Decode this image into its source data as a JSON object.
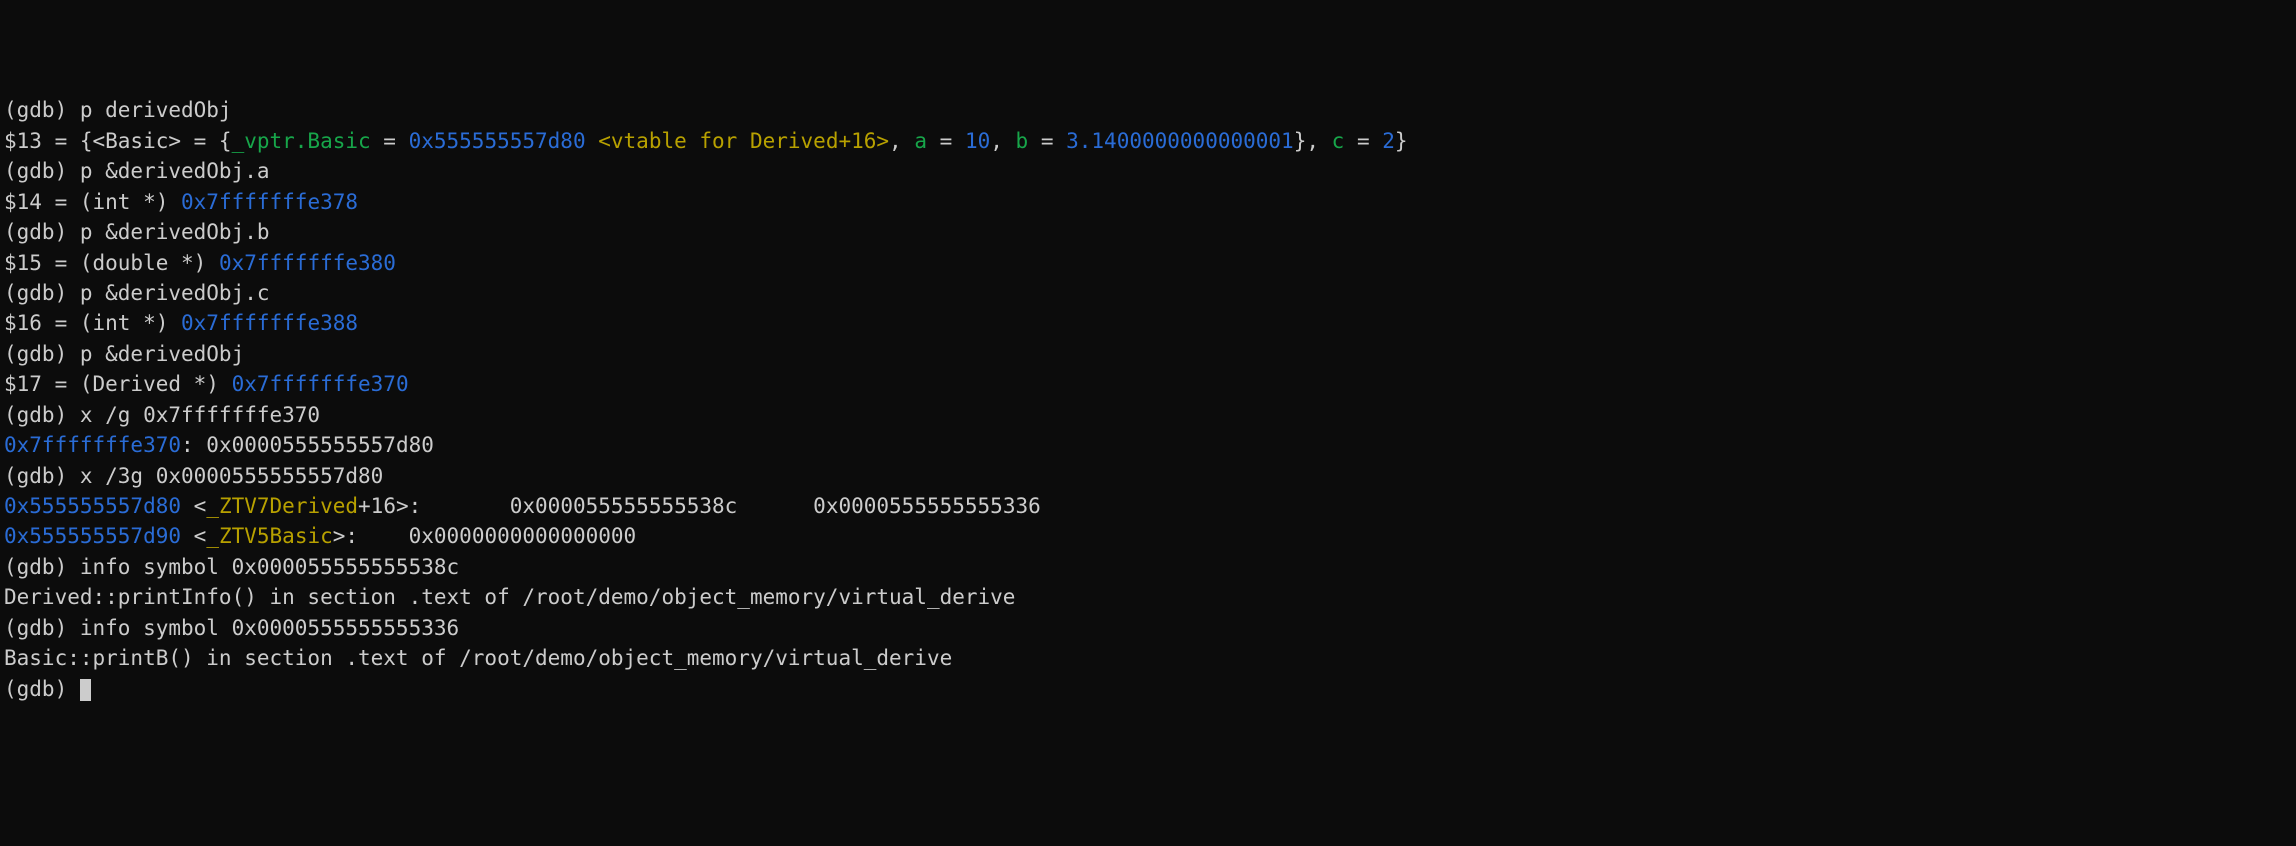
{
  "l1": {
    "prompt": "(gdb) ",
    "cmd": "p derivedObj"
  },
  "l2": {
    "a": "$13 = {<Basic> = {",
    "b": "_vptr.Basic",
    "c": " = ",
    "d": "0x555555557d80",
    "e": " <vtable for Derived+16>",
    "f": ", ",
    "g": "a",
    "h": " = ",
    "i": "10",
    "j": ", ",
    "k": "b",
    "l": " = ",
    "m": "3.1400000000000001",
    "n": "}, ",
    "o": "c",
    "p": " = ",
    "q": "2",
    "r": "}"
  },
  "l3": {
    "prompt": "(gdb) ",
    "cmd": "p &derivedObj.a"
  },
  "l4": {
    "a": "$14 = (int *) ",
    "b": "0x7fffffffe378"
  },
  "l5": {
    "prompt": "(gdb) ",
    "cmd": "p &derivedObj.b"
  },
  "l6": {
    "a": "$15 = (double *) ",
    "b": "0x7fffffffe380"
  },
  "l7": {
    "prompt": "(gdb) ",
    "cmd": "p &derivedObj.c"
  },
  "l8": {
    "a": "$16 = (int *) ",
    "b": "0x7fffffffe388"
  },
  "l9": {
    "prompt": "(gdb) ",
    "cmd": "p &derivedObj"
  },
  "l10": {
    "a": "$17 = (Derived *) ",
    "b": "0x7fffffffe370"
  },
  "l11": {
    "prompt": "(gdb) ",
    "cmd": "x /g 0x7fffffffe370"
  },
  "l12": {
    "a": "0x7fffffffe370",
    "b": ": 0x0000555555557d80"
  },
  "l13": {
    "prompt": "(gdb) ",
    "cmd": "x /3g 0x0000555555557d80"
  },
  "l14": {
    "a": "0x555555557d80",
    "b": " <",
    "c": "_ZTV7Derived",
    "d": "+16>:       0x000055555555538c      0x0000555555555336"
  },
  "l15": {
    "a": "0x555555557d90",
    "b": " <",
    "c": "_ZTV5Basic",
    "d": ">:    0x0000000000000000"
  },
  "l16": {
    "prompt": "(gdb) ",
    "cmd": "info symbol 0x000055555555538c"
  },
  "l17": {
    "a": "Derived::printInfo() in section .text of /root/demo/object_memory/virtual_derive"
  },
  "l18": {
    "prompt": "(gdb) ",
    "cmd": "info symbol 0x0000555555555336"
  },
  "l19": {
    "a": "Basic::printB() in section .text of /root/demo/object_memory/virtual_derive"
  },
  "l20": {
    "prompt": "(gdb) "
  }
}
